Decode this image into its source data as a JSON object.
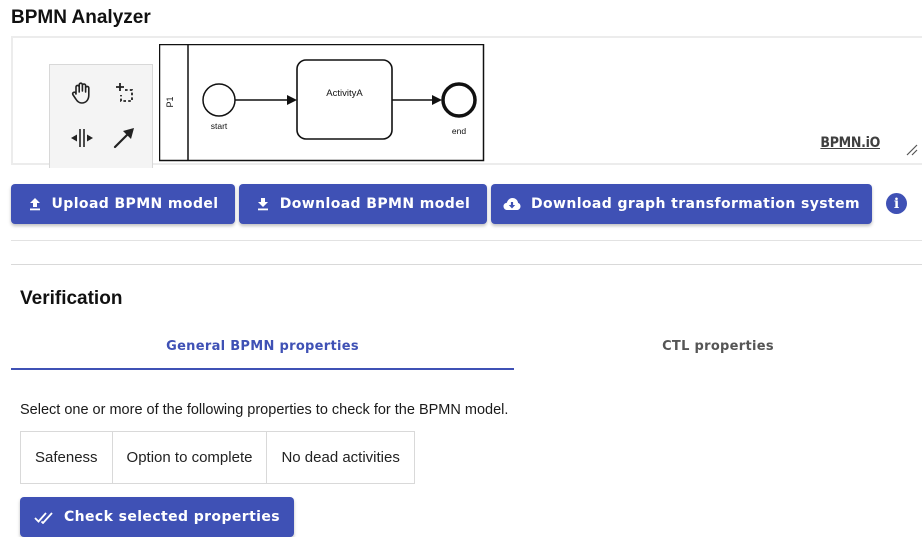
{
  "app": {
    "title": "BPMN Analyzer"
  },
  "diagram": {
    "pool_label": "P1",
    "start_label": "start",
    "task_label": "ActivityA",
    "end_label": "end",
    "watermark": "BPMN.iO"
  },
  "palette": {
    "tools": [
      "hand-tool",
      "lasso-tool",
      "space-tool",
      "connect-tool"
    ]
  },
  "toolbar": {
    "upload_label": "Upload BPMN model",
    "download_label": "Download BPMN model",
    "download_gts_label": "Download graph transformation system",
    "info_label": "i"
  },
  "verification": {
    "heading": "Verification",
    "tabs": [
      {
        "label": "General BPMN properties",
        "active": true
      },
      {
        "label": "CTL properties",
        "active": false
      }
    ],
    "instruction": "Select one or more of the following properties to check for the BPMN model.",
    "properties": [
      "Safeness",
      "Option to complete",
      "No dead activities"
    ],
    "check_label": "Check selected properties"
  },
  "colors": {
    "primary": "#3f51b5"
  }
}
